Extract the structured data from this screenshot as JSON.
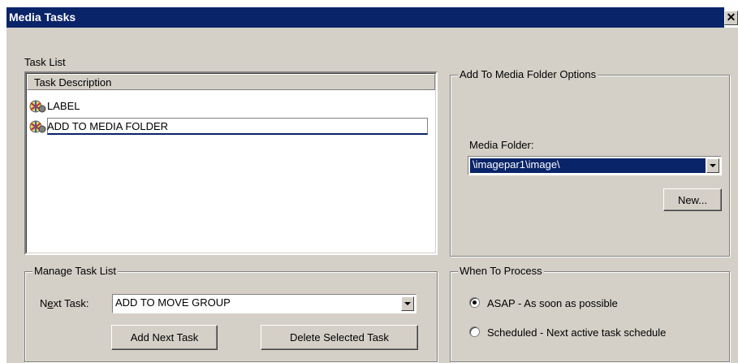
{
  "window": {
    "title": "Media Tasks",
    "close_glyph": "✕"
  },
  "task_list": {
    "label": "Task List",
    "header": "Task Description",
    "items": [
      {
        "label": "LABEL",
        "icon": "task-icon",
        "selected": false
      },
      {
        "label": "ADD TO MEDIA FOLDER",
        "icon": "task-icon",
        "selected": true
      }
    ]
  },
  "options_group": {
    "title": "Add To Media Folder Options",
    "media_folder_label": "Media Folder:",
    "media_folder_value": "\\imagepar1\\image\\",
    "new_button": "New..."
  },
  "manage_group": {
    "title": "Manage Task List",
    "next_task_label_prefix": "N",
    "next_task_label_underlined": "e",
    "next_task_label_suffix": "xt Task:",
    "next_task_value": "ADD TO MOVE GROUP",
    "add_next_button": "Add Next Task",
    "delete_button": "Delete Selected Task"
  },
  "process_group": {
    "title": "When To Process",
    "options": [
      {
        "label": "ASAP - As soon as possible",
        "checked": true
      },
      {
        "label": "Scheduled - Next active task schedule",
        "checked": false
      }
    ]
  },
  "colors": {
    "title_bar": "#0a246a",
    "selection": "#0a246a",
    "face": "#d4d0c8"
  }
}
